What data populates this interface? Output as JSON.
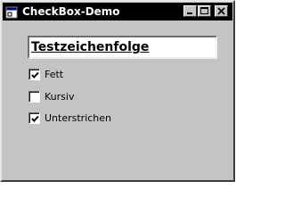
{
  "window": {
    "title": "CheckBox-Demo"
  },
  "caption_buttons": {
    "minimize_icon": "minimize-icon",
    "maximize_icon": "maximize-icon",
    "close_icon": "close-icon"
  },
  "textbox": {
    "value": "Testzeichenfolge"
  },
  "checkboxes": [
    {
      "label": "Fett",
      "checked": true
    },
    {
      "label": "Kursiv",
      "checked": false
    },
    {
      "label": "Unterstrichen",
      "checked": true
    }
  ],
  "colors": {
    "titlebar": "#000000",
    "window_background": "#c4c4c4"
  }
}
